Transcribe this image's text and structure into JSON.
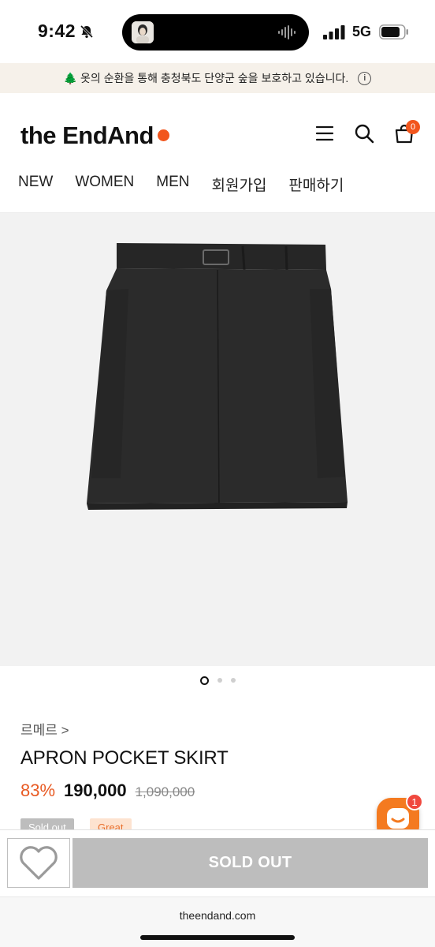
{
  "status": {
    "time": "9:42",
    "network": "5G"
  },
  "banner": {
    "icon": "tree-emoji",
    "text": "🌲 옷의 순환을 통해 충청북도 단양군 숲을 보호하고 있습니다.",
    "info": "i"
  },
  "header": {
    "logo": "the EndAnd",
    "cart_count": "0",
    "nav": [
      "NEW",
      "WOMEN",
      "MEN",
      "회원가입",
      "판매하기"
    ]
  },
  "carousel": {
    "total": 3,
    "active": 0
  },
  "product": {
    "brand": "르메르 >",
    "title": "APRON POCKET SKIRT",
    "discount": "83%",
    "price": "190,000",
    "original_price": "1,090,000",
    "tags": [
      "Sold out",
      "Great"
    ]
  },
  "chat": {
    "badge": "1"
  },
  "actions": {
    "sold_out_label": "SOLD OUT"
  },
  "browser": {
    "url": "theendand.com"
  },
  "colors": {
    "accent": "#f2561d",
    "discount": "#e85a23",
    "disabled": "#bdbdbd"
  }
}
